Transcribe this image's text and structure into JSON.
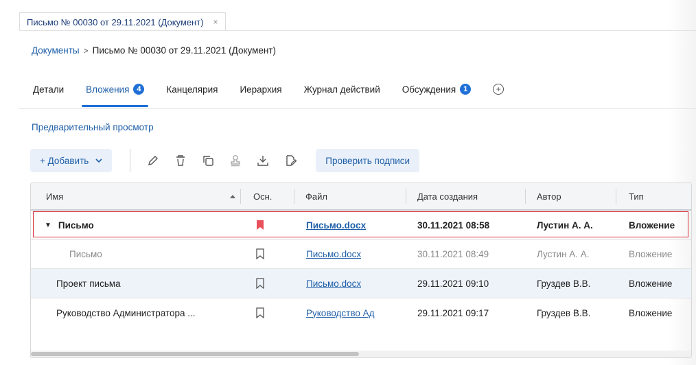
{
  "window": {
    "tab_title": "Письмо № 00030 от 29.11.2021 (Документ)",
    "close_glyph": "×"
  },
  "breadcrumb": {
    "root": "Документы",
    "separator": ">",
    "current": "Письмо № 00030 от 29.11.2021 (Документ)"
  },
  "tabs": [
    {
      "label": "Детали"
    },
    {
      "label": "Вложения",
      "badge": "4",
      "active": true
    },
    {
      "label": "Канцелярия"
    },
    {
      "label": "Иерархия"
    },
    {
      "label": "Журнал действий"
    },
    {
      "label": "Обсуждения",
      "badge": "1"
    }
  ],
  "preview_link": "Предварительный просмотр",
  "toolbar": {
    "add_label": "+ Добавить",
    "check_signatures_label": "Проверить подписи",
    "icons": [
      "edit-icon",
      "delete-icon",
      "copy-icon",
      "stamp-icon",
      "download-icon",
      "sign-file-icon"
    ]
  },
  "table": {
    "columns": [
      "Имя",
      "Осн.",
      "Файл",
      "Дата создания",
      "Автор",
      "Тип"
    ],
    "rows": [
      {
        "name": "Письмо",
        "main": true,
        "file": "Письмо.docx",
        "date": "30.11.2021 08:58",
        "author": "Лустин А. А.",
        "type": "Вложение",
        "style": "bold",
        "expander": "▼"
      },
      {
        "name": "Письмо",
        "main": false,
        "file": "Письмо.docx",
        "date": "30.11.2021 08:49",
        "author": "Лустин А. А.",
        "type": "Вложение",
        "style": "muted"
      },
      {
        "name": "Проект письма",
        "main": false,
        "file": "Письмо.docx",
        "date": "29.11.2021 09:10",
        "author": "Груздев В.В.",
        "type": "Вложение",
        "style": "selected"
      },
      {
        "name": "Руководство Администратора ...",
        "main": false,
        "file": "Руководство Ад",
        "date": "29.11.2021 09:17",
        "author": "Груздев В.В.",
        "type": "Вложение",
        "style": "normal"
      }
    ]
  },
  "colors": {
    "accent": "#1f6fd6",
    "link": "#1f5fa8",
    "bookmark_active": "#e8505b",
    "highlight_border": "#d8303a"
  }
}
